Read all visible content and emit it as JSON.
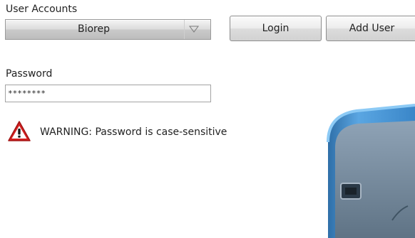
{
  "accounts": {
    "label": "User Accounts",
    "selected": "Biorep"
  },
  "buttons": {
    "login": "Login",
    "add_user": "Add User"
  },
  "password": {
    "label": "Password",
    "value": "********"
  },
  "warning": {
    "text": "WARNING: Password is case-sensitive",
    "icon": "warning-triangle-icon"
  },
  "device": {
    "image": "device-illustration"
  },
  "colors": {
    "warning_red": "#d42020",
    "device_blue": "#3b8fd0"
  }
}
